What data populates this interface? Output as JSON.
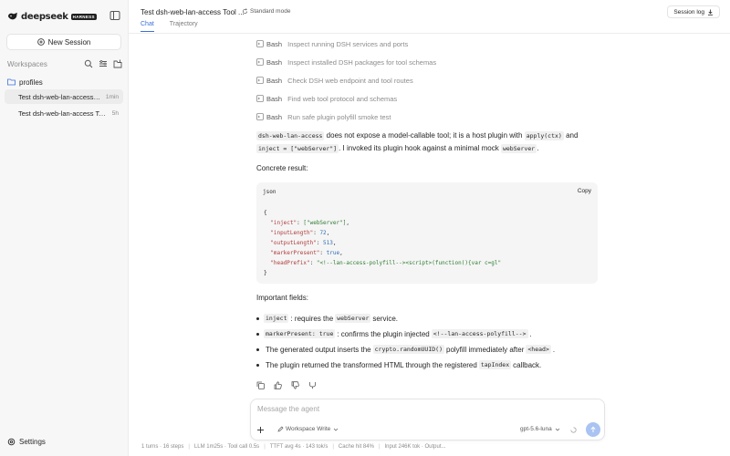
{
  "sidebar": {
    "logo_text": "deepseek",
    "logo_badge": "HARNESS",
    "new_session_label": "New Session",
    "workspaces_label": "Workspaces",
    "folder_name": "profiles",
    "sessions": [
      {
        "title": "Test dsh-web-lan-access Tool ...",
        "time": "1min",
        "active": true
      },
      {
        "title": "Test dsh-web-lan-access Tool ...",
        "time": "5h",
        "active": false
      }
    ],
    "settings_label": "Settings"
  },
  "header": {
    "title": "Test dsh-web-lan-access Tool ...",
    "mode": "Standard mode",
    "tabs": [
      "Chat",
      "Trajectory"
    ],
    "session_log_label": "Session log"
  },
  "tool_calls": [
    {
      "name": "Bash",
      "desc": "Inspect running DSH services and ports"
    },
    {
      "name": "Bash",
      "desc": "Inspect installed DSH packages for tool schemas"
    },
    {
      "name": "Bash",
      "desc": "Check DSH web endpoint and tool routes"
    },
    {
      "name": "Bash",
      "desc": "Find web tool protocol and schemas"
    },
    {
      "name": "Bash",
      "desc": "Run safe plugin polyfill smoke test"
    }
  ],
  "message": {
    "intro": {
      "code1": "dsh-web-lan-access",
      "text1": " does not expose a model-callable tool; it is a host plugin with ",
      "code2": "apply(ctx)",
      "text2": " and",
      "code3": "inject = [\"webServer\"]",
      "text3": ". I invoked its plugin hook against a minimal mock ",
      "code4": "webServer",
      "text4": "."
    },
    "concrete_label": "Concrete result:",
    "code_lang": "json",
    "copy_label": "Copy",
    "json_lines": [
      {
        "key": "\"inject\"",
        "val": "[\"webServer\"]",
        "kind": "arr"
      },
      {
        "key": "\"inputLength\"",
        "val": "72",
        "kind": "num"
      },
      {
        "key": "\"outputLength\"",
        "val": "513",
        "kind": "num"
      },
      {
        "key": "\"markerPresent\"",
        "val": "true",
        "kind": "bool"
      },
      {
        "key": "\"headPrefix\"",
        "val": "\"<!--lan-access-polyfill--><script>(function(){var c=gl\"",
        "kind": "str"
      }
    ],
    "important_label": "Important fields:",
    "bullets": [
      {
        "code_a": "inject",
        "text_a": ": requires the ",
        "code_b": "webServer",
        "text_b": " service."
      },
      {
        "code_a": "markerPresent: true",
        "text_a": ": confirms the plugin injected ",
        "code_b": "<!--lan-access-polyfill-->",
        "text_b": "."
      },
      {
        "code_a": "",
        "text_a": "The generated output inserts the ",
        "code_b": "crypto.randomUUID()",
        "text_b": " polyfill immediately after ",
        "code_c": "<head>",
        "text_c": "."
      },
      {
        "code_a": "",
        "text_a": "The plugin returned the transformed HTML through the registered ",
        "code_b": "tapIndex",
        "text_b": " callback."
      }
    ]
  },
  "composer": {
    "placeholder": "Message the agent",
    "workspace_mode": "Workspace Write",
    "model": "gpt-5.6-luna"
  },
  "status": [
    "1 turns · 16 steps",
    "LLM 1m25s · Tool call 0.5s",
    "TTFT avg 4s · 143 tok/s",
    "Cache hit 84%",
    "Input 246K tok · Output..."
  ]
}
